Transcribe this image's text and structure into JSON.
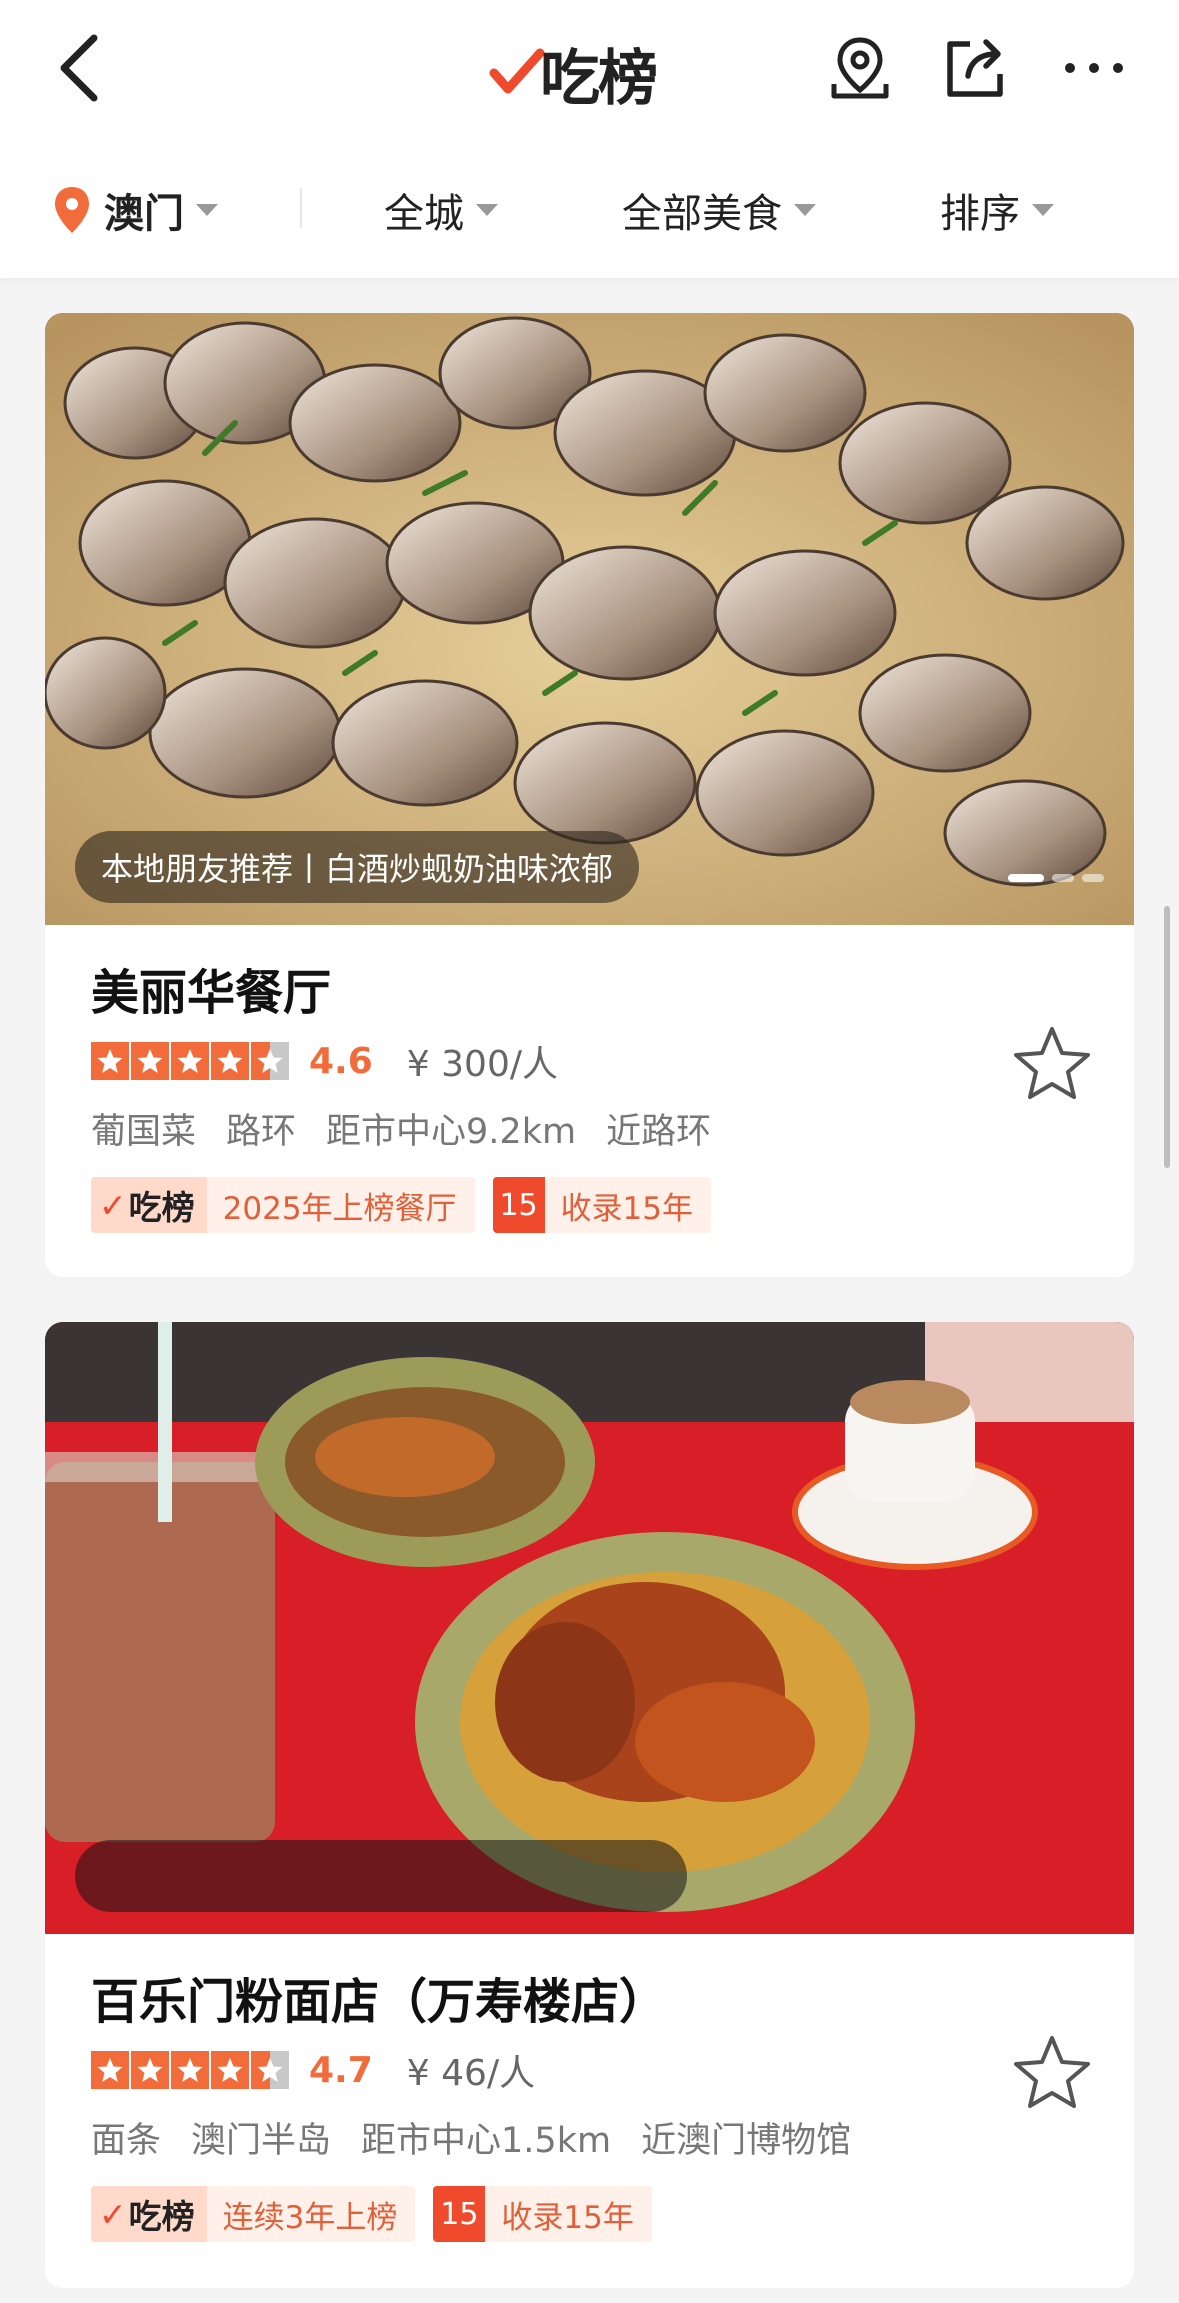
{
  "header": {
    "brand_label": "吃榜",
    "back_icon": "chevron-left-icon",
    "icons": [
      "map-pin-icon",
      "share-icon",
      "more-icon"
    ]
  },
  "filters": {
    "city": "澳门",
    "area": "全城",
    "category": "全部美食",
    "sort": "排序"
  },
  "restaurants": [
    {
      "caption": "本地朋友推荐丨白酒炒蚬奶油味浓郁",
      "name": "美丽华餐厅",
      "stars": 4.5,
      "score": "4.6",
      "price": "¥ 300/人",
      "tags": [
        "葡国菜",
        "路环",
        "距市中心9.2km",
        "近路环"
      ],
      "badge_logo": "吃榜",
      "badge_text": "2025年上榜餐厅",
      "collect_num": "15",
      "collect_text": "收录15年"
    },
    {
      "caption": "",
      "name": "百乐门粉面店（万寿楼店）",
      "stars": 4.5,
      "score": "4.7",
      "price": "¥ 46/人",
      "tags": [
        "面条",
        "澳门半岛",
        "距市中心1.5km",
        "近澳门博物馆"
      ],
      "badge_logo": "吃榜",
      "badge_text": "连续3年上榜",
      "collect_num": "15",
      "collect_text": "收录15年"
    }
  ],
  "colors": {
    "accent": "#f26b3a",
    "badge_red": "#f04a2c",
    "badge_bg": "#fff0e9"
  }
}
